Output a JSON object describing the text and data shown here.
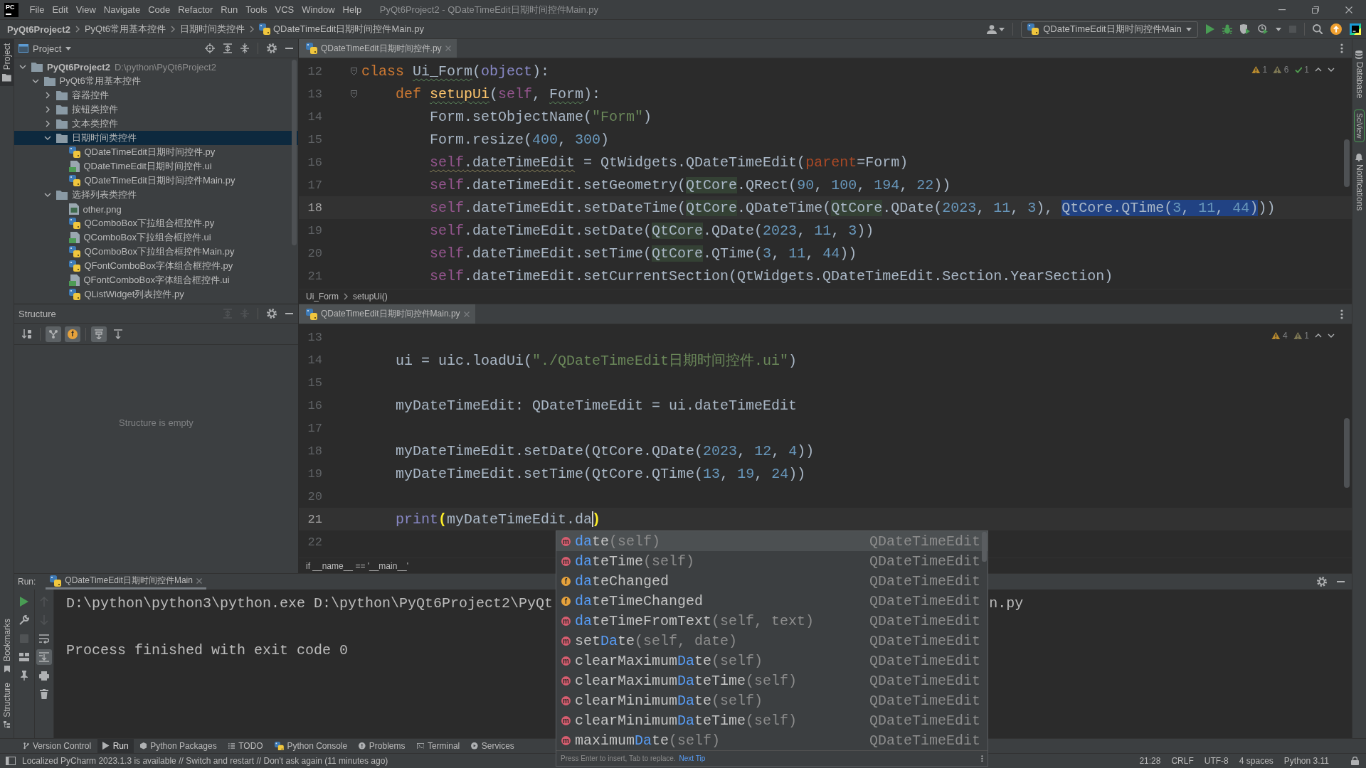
{
  "menu_bar": {
    "logo": "PC",
    "items": [
      "File",
      "Edit",
      "View",
      "Navigate",
      "Code",
      "Refactor",
      "Run",
      "Tools",
      "VCS",
      "Window",
      "Help"
    ],
    "title": "PyQt6Project2 - QDateTimeEdit日期时间控件Main.py"
  },
  "nav_bar": {
    "breadcrumbs": [
      {
        "label": "PyQt6Project2",
        "kind": "project"
      },
      {
        "label": "PyQt6常用基本控件",
        "kind": "folder"
      },
      {
        "label": "日期时间类控件",
        "kind": "folder"
      },
      {
        "label": "QDateTimeEdit日期时间控件Main.py",
        "kind": "python"
      }
    ],
    "run_config": "QDateTimeEdit日期时间控件Main",
    "actions": [
      {
        "kind": "run",
        "disabled": false
      },
      {
        "kind": "debug",
        "disabled": false
      },
      {
        "kind": "coverage",
        "disabled": false
      },
      {
        "kind": "profile",
        "disabled": false
      },
      {
        "kind": "stop",
        "disabled": true
      }
    ]
  },
  "left_strip": {
    "top": [
      {
        "label": "Project",
        "kind": "project",
        "selected": true
      }
    ],
    "bottom": [
      {
        "label": "Bookmarks",
        "kind": "bookmarks",
        "selected": false
      },
      {
        "label": "Structure",
        "kind": "structure",
        "selected": false
      }
    ]
  },
  "right_strip": [
    {
      "label": "Database",
      "kind": "database",
      "selected": false
    },
    {
      "label": "SciView",
      "kind": "sciview",
      "selected": false
    },
    {
      "label": "Notifications",
      "kind": "notifications",
      "selected": false
    }
  ],
  "project_panel": {
    "title": "Project",
    "tree": [
      {
        "label": "PyQt6Project2",
        "path": "D:\\python\\PyQt6Project2",
        "kind": "project",
        "expanded": true,
        "selected": false,
        "children": [
          {
            "label": "PyQt6常用基本控件",
            "kind": "folder",
            "expanded": true,
            "selected": false,
            "children": [
              {
                "label": "容器控件",
                "kind": "folder",
                "expanded": false,
                "selected": false
              },
              {
                "label": "按钮类控件",
                "kind": "folder",
                "expanded": false,
                "selected": false
              },
              {
                "label": "文本类控件",
                "kind": "folder",
                "expanded": false,
                "selected": false
              },
              {
                "label": "日期时间类控件",
                "kind": "folder",
                "expanded": true,
                "selected": true,
                "children": [
                  {
                    "label": "QDateTimeEdit日期时间控件.py",
                    "kind": "python",
                    "selected": false
                  },
                  {
                    "label": "QDateTimeEdit日期时间控件.ui",
                    "kind": "ui",
                    "selected": false
                  },
                  {
                    "label": "QDateTimeEdit日期时间控件Main.py",
                    "kind": "python",
                    "selected": false
                  }
                ]
              },
              {
                "label": "选择列表类控件",
                "kind": "folder",
                "expanded": true,
                "selected": false,
                "children": [
                  {
                    "label": "other.png",
                    "kind": "image",
                    "selected": false
                  },
                  {
                    "label": "QComboBox下拉组合框控件.py",
                    "kind": "python",
                    "selected": false
                  },
                  {
                    "label": "QComboBox下拉组合框控件.ui",
                    "kind": "ui",
                    "selected": false
                  },
                  {
                    "label": "QComboBox下拉组合框控件Main.py",
                    "kind": "python",
                    "selected": false
                  },
                  {
                    "label": "QFontComboBox字体组合框控件.py",
                    "kind": "python",
                    "selected": false
                  },
                  {
                    "label": "QFontComboBox字体组合框控件.ui",
                    "kind": "ui",
                    "selected": false
                  },
                  {
                    "label": "QListWidget列表控件.py",
                    "kind": "python",
                    "selected": false
                  }
                ]
              }
            ]
          }
        ]
      }
    ]
  },
  "structure_panel": {
    "title": "Structure",
    "header_actions": [
      {
        "kind": "expand-all",
        "disabled": true
      },
      {
        "kind": "collapse-all",
        "disabled": true
      }
    ],
    "toolbar": [
      {
        "kind": "sort",
        "on": false
      },
      {
        "kind": "inherited",
        "on": true
      },
      {
        "kind": "fields",
        "icon": "f",
        "on": true
      },
      {
        "kind": "scroll-to-source",
        "on": true
      },
      {
        "kind": "scroll-from-source",
        "on": false
      }
    ],
    "empty_text": "Structure is empty"
  },
  "editors": [
    {
      "tab": {
        "label": "QDateTimeEdit日期时间控件.py",
        "selected": true
      },
      "inspections": [
        {
          "kind": "warning",
          "count": "1"
        },
        {
          "kind": "weak-warning",
          "count": "6"
        },
        {
          "kind": "typo",
          "count": "1"
        }
      ],
      "lines": [
        {
          "number": "12",
          "current": false,
          "fold": true,
          "tokens": [
            {
              "kind": "kw",
              "text": "class "
            },
            {
              "kind": "typo",
              "tokens": [
                {
                  "kind": "plain",
                  "text": "Ui_Form"
                }
              ]
            },
            {
              "kind": "plain",
              "text": "("
            },
            {
              "kind": "builtin",
              "text": "object"
            },
            {
              "kind": "plain",
              "text": "):"
            }
          ]
        },
        {
          "number": "13",
          "current": false,
          "fold": true,
          "tokens": [
            {
              "kind": "kw",
              "text": "    def "
            },
            {
              "kind": "typo",
              "tokens": [
                {
                  "kind": "fn",
                  "text": "setupUi"
                }
              ]
            },
            {
              "kind": "plain",
              "text": "("
            },
            {
              "kind": "self",
              "text": "self"
            },
            {
              "kind": "plain",
              "text": ", "
            },
            {
              "kind": "typo",
              "tokens": [
                {
                  "kind": "plain",
                  "text": "Form"
                }
              ]
            },
            {
              "kind": "plain",
              "text": "):"
            }
          ]
        },
        {
          "number": "14",
          "current": false,
          "fold": false,
          "tokens": [
            {
              "kind": "plain",
              "text": "        Form.setObjectName("
            },
            {
              "kind": "str",
              "text": "\"Form\""
            },
            {
              "kind": "plain",
              "text": ")"
            }
          ]
        },
        {
          "number": "15",
          "current": false,
          "fold": false,
          "tokens": [
            {
              "kind": "plain",
              "text": "        Form.resize("
            },
            {
              "kind": "num",
              "text": "400"
            },
            {
              "kind": "plain",
              "text": ", "
            },
            {
              "kind": "num",
              "text": "300"
            },
            {
              "kind": "plain",
              "text": ")"
            }
          ]
        },
        {
          "number": "16",
          "current": false,
          "fold": false,
          "tokens": [
            {
              "kind": "warning",
              "tokens": [
                {
                  "kind": "self",
                  "text": "        self"
                },
                {
                  "kind": "plain",
                  "text": ".dateTimeEdit"
                }
              ]
            },
            {
              "kind": "plain",
              "text": " = QtWidgets.QDateTimeEdit("
            },
            {
              "kind": "param",
              "text": "parent"
            },
            {
              "kind": "plain",
              "text": "=Form)"
            }
          ]
        },
        {
          "number": "17",
          "current": false,
          "fold": false,
          "tokens": [
            {
              "kind": "self",
              "text": "        self"
            },
            {
              "kind": "plain",
              "text": ".dateTimeEdit.setGeometry("
            },
            {
              "kind": "usage",
              "tokens": [
                {
                  "kind": "plain",
                  "text": "QtCore"
                }
              ]
            },
            {
              "kind": "plain",
              "text": ".QRect("
            },
            {
              "kind": "num",
              "text": "90"
            },
            {
              "kind": "plain",
              "text": ", "
            },
            {
              "kind": "num",
              "text": "100"
            },
            {
              "kind": "plain",
              "text": ", "
            },
            {
              "kind": "num",
              "text": "194"
            },
            {
              "kind": "plain",
              "text": ", "
            },
            {
              "kind": "num",
              "text": "22"
            },
            {
              "kind": "plain",
              "text": "))"
            }
          ]
        },
        {
          "number": "18",
          "current": true,
          "fold": false,
          "tokens": [
            {
              "kind": "self",
              "text": "        self"
            },
            {
              "kind": "plain",
              "text": ".dateTimeEdit.setDateTime("
            },
            {
              "kind": "usage",
              "tokens": [
                {
                  "kind": "plain",
                  "text": "QtCore"
                }
              ]
            },
            {
              "kind": "plain",
              "text": ".QDateTime("
            },
            {
              "kind": "usage",
              "tokens": [
                {
                  "kind": "plain",
                  "text": "QtCore"
                }
              ]
            },
            {
              "kind": "plain",
              "text": ".QDate("
            },
            {
              "kind": "num",
              "text": "2023"
            },
            {
              "kind": "plain",
              "text": ", "
            },
            {
              "kind": "num",
              "text": "11"
            },
            {
              "kind": "plain",
              "text": ", "
            },
            {
              "kind": "num",
              "text": "3"
            },
            {
              "kind": "plain",
              "text": "), "
            },
            {
              "kind": "selection",
              "tokens": [
                {
                  "kind": "plain",
                  "text": "QtCore.QTime("
                },
                {
                  "kind": "num",
                  "text": "3"
                },
                {
                  "kind": "plain",
                  "text": ", "
                },
                {
                  "kind": "num",
                  "text": "11"
                },
                {
                  "kind": "plain",
                  "text": ", "
                },
                {
                  "kind": "num",
                  "text": "44"
                },
                {
                  "kind": "plain",
                  "text": ")"
                }
              ]
            },
            {
              "kind": "plain",
              "text": "))"
            }
          ]
        },
        {
          "number": "19",
          "current": false,
          "fold": false,
          "tokens": [
            {
              "kind": "self",
              "text": "        self"
            },
            {
              "kind": "plain",
              "text": ".dateTimeEdit.setDate("
            },
            {
              "kind": "usage",
              "tokens": [
                {
                  "kind": "plain",
                  "text": "QtCore"
                }
              ]
            },
            {
              "kind": "plain",
              "text": ".QDate("
            },
            {
              "kind": "num",
              "text": "2023"
            },
            {
              "kind": "plain",
              "text": ", "
            },
            {
              "kind": "num",
              "text": "11"
            },
            {
              "kind": "plain",
              "text": ", "
            },
            {
              "kind": "num",
              "text": "3"
            },
            {
              "kind": "plain",
              "text": "))"
            }
          ]
        },
        {
          "number": "20",
          "current": false,
          "fold": false,
          "tokens": [
            {
              "kind": "self",
              "text": "        self"
            },
            {
              "kind": "plain",
              "text": ".dateTimeEdit.setTime("
            },
            {
              "kind": "usage",
              "tokens": [
                {
                  "kind": "plain",
                  "text": "QtCore"
                }
              ]
            },
            {
              "kind": "plain",
              "text": ".QTime("
            },
            {
              "kind": "num",
              "text": "3"
            },
            {
              "kind": "plain",
              "text": ", "
            },
            {
              "kind": "num",
              "text": "11"
            },
            {
              "kind": "plain",
              "text": ", "
            },
            {
              "kind": "num",
              "text": "44"
            },
            {
              "kind": "plain",
              "text": "))"
            }
          ]
        },
        {
          "number": "21",
          "current": false,
          "fold": false,
          "tokens": [
            {
              "kind": "self",
              "text": "        self"
            },
            {
              "kind": "plain",
              "text": ".dateTimeEdit.setCurrentSection(QtWidgets.QDateTimeEdit.Section.YearSection)"
            }
          ]
        }
      ],
      "breadcrumbs": [
        "Ui_Form",
        "setupUi()"
      ]
    },
    {
      "tab": {
        "label": "QDateTimeEdit日期时间控件Main.py",
        "selected": true
      },
      "inspections": [
        {
          "kind": "warning",
          "count": "4"
        },
        {
          "kind": "weak-warning",
          "count": "1"
        }
      ],
      "lines": [
        {
          "number": "13",
          "current": false,
          "fold": false
        },
        {
          "number": "14",
          "current": false,
          "fold": false,
          "tokens": [
            {
              "kind": "plain",
              "text": "    ui = uic.loadUi("
            },
            {
              "kind": "str",
              "text": "\"./QDateTimeEdit日期时间控件.ui\""
            },
            {
              "kind": "plain",
              "text": ")"
            }
          ]
        },
        {
          "number": "15",
          "current": false,
          "fold": false
        },
        {
          "number": "16",
          "current": false,
          "fold": false,
          "tokens": [
            {
              "kind": "plain",
              "text": "    myDateTimeEdit: QDateTimeEdit = ui.dateTimeEdit"
            }
          ]
        },
        {
          "number": "17",
          "current": false,
          "fold": false
        },
        {
          "number": "18",
          "current": false,
          "fold": false,
          "tokens": [
            {
              "kind": "plain",
              "text": "    myDateTimeEdit.setDate(QtCore.QDate("
            },
            {
              "kind": "num",
              "text": "2023"
            },
            {
              "kind": "plain",
              "text": ", "
            },
            {
              "kind": "num",
              "text": "12"
            },
            {
              "kind": "plain",
              "text": ", "
            },
            {
              "kind": "num",
              "text": "4"
            },
            {
              "kind": "plain",
              "text": "))"
            }
          ]
        },
        {
          "number": "19",
          "current": false,
          "fold": false,
          "tokens": [
            {
              "kind": "plain",
              "text": "    myDateTimeEdit.setTime(QtCore.QTime("
            },
            {
              "kind": "num",
              "text": "13"
            },
            {
              "kind": "plain",
              "text": ", "
            },
            {
              "kind": "num",
              "text": "19"
            },
            {
              "kind": "plain",
              "text": ", "
            },
            {
              "kind": "num",
              "text": "24"
            },
            {
              "kind": "plain",
              "text": "))"
            }
          ]
        },
        {
          "number": "20",
          "current": false,
          "fold": false
        },
        {
          "number": "21",
          "current": true,
          "fold": false,
          "tokens": [
            {
              "kind": "builtin",
              "text": "    print"
            },
            {
              "kind": "brace",
              "text": "("
            },
            {
              "kind": "plain",
              "text": "myDateTimeEdit.da"
            },
            {
              "kind": "caret"
            },
            {
              "kind": "brace",
              "text": ")"
            }
          ]
        },
        {
          "number": "22",
          "current": false,
          "fold": false
        }
      ],
      "breadcrumbs": [
        "if __name__ == '__main__'"
      ]
    }
  ],
  "completion": {
    "items": [
      {
        "kind": "method",
        "icon": "m",
        "match": "da",
        "after": "te",
        "params": "(self)",
        "type": "QDateTimeEdit",
        "selected": true
      },
      {
        "kind": "method",
        "icon": "m",
        "match": "da",
        "after": "teTime",
        "params": "(self)",
        "type": "QDateTimeEdit",
        "selected": false
      },
      {
        "kind": "field",
        "icon": "f",
        "match": "da",
        "after": "teChanged",
        "type": "QDateTimeEdit",
        "selected": false
      },
      {
        "kind": "field",
        "icon": "f",
        "match": "da",
        "after": "teTimeChanged",
        "type": "QDateTimeEdit",
        "selected": false
      },
      {
        "kind": "method",
        "icon": "m",
        "match": "da",
        "after": "teTimeFromText",
        "params": "(self, text)",
        "type": "QDateTimeEdit",
        "selected": false
      },
      {
        "kind": "method",
        "icon": "m",
        "before": "set",
        "match": "Da",
        "after": "te",
        "params": "(self, date)",
        "type": "QDateTimeEdit",
        "selected": false
      },
      {
        "kind": "method",
        "icon": "m",
        "before": "clearMaximum",
        "match": "Da",
        "after": "te",
        "params": "(self)",
        "type": "QDateTimeEdit",
        "selected": false
      },
      {
        "kind": "method",
        "icon": "m",
        "before": "clearMaximum",
        "match": "Da",
        "after": "teTime",
        "params": "(self)",
        "type": "QDateTimeEdit",
        "selected": false
      },
      {
        "kind": "method",
        "icon": "m",
        "before": "clearMinimum",
        "match": "Da",
        "after": "te",
        "params": "(self)",
        "type": "QDateTimeEdit",
        "selected": false
      },
      {
        "kind": "method",
        "icon": "m",
        "before": "clearMinimum",
        "match": "Da",
        "after": "teTime",
        "params": "(self)",
        "type": "QDateTimeEdit",
        "selected": false
      },
      {
        "kind": "method",
        "icon": "m",
        "before": "maximum",
        "match": "Da",
        "after": "te",
        "params": "(self)",
        "type": "QDateTimeEdit",
        "selected": false
      }
    ],
    "hint": "Press Enter to insert, Tab to replace.",
    "link": "Next Tip"
  },
  "run_panel": {
    "label": "Run:",
    "tab": {
      "label": "QDateTimeEdit日期时间控件Main",
      "selected": true
    },
    "toolbar": [
      [
        {
          "kind": "rerun",
          "disabled": false,
          "on": false
        },
        {
          "kind": "wrench",
          "disabled": false,
          "on": false
        },
        {
          "kind": "stop",
          "disabled": true,
          "on": false
        },
        {
          "kind": "layout",
          "disabled": false,
          "on": false
        },
        {
          "kind": "pin",
          "disabled": false,
          "on": false
        }
      ],
      [
        {
          "kind": "up",
          "disabled": true,
          "on": false
        },
        {
          "kind": "down",
          "disabled": true,
          "on": false
        },
        {
          "kind": "wrap",
          "disabled": false,
          "on": false
        },
        {
          "kind": "scroll-end",
          "disabled": false,
          "on": true
        },
        {
          "kind": "print",
          "disabled": false,
          "on": false
        },
        {
          "kind": "trash",
          "disabled": false,
          "on": false
        }
      ]
    ],
    "output": [
      {
        "text": "D:\\python\\python3\\python.exe D:\\python\\PyQt6Project2\\PyQt",
        "tail": "n.py"
      },
      {
        "text": "Process finished with exit code 0"
      }
    ]
  },
  "tool_bar": [
    {
      "label": "Version Control",
      "kind": "vcs",
      "selected": false
    },
    {
      "label": "Run",
      "kind": "run",
      "selected": true
    },
    {
      "label": "Python Packages",
      "kind": "packages",
      "selected": false
    },
    {
      "label": "TODO",
      "kind": "todo",
      "selected": false
    },
    {
      "label": "Python Console",
      "kind": "console",
      "selected": false
    },
    {
      "label": "Problems",
      "kind": "problems",
      "selected": false
    },
    {
      "label": "Terminal",
      "kind": "terminal",
      "selected": false
    },
    {
      "label": "Services",
      "kind": "services",
      "selected": false
    }
  ],
  "status_bar": {
    "message": "Localized PyCharm 2023.1.3 is available // Switch and restart // Don't ask again (11 minutes ago)",
    "items": [
      "21:28",
      "CRLF",
      "UTF-8",
      "4 spaces",
      "Python 3.11"
    ]
  }
}
